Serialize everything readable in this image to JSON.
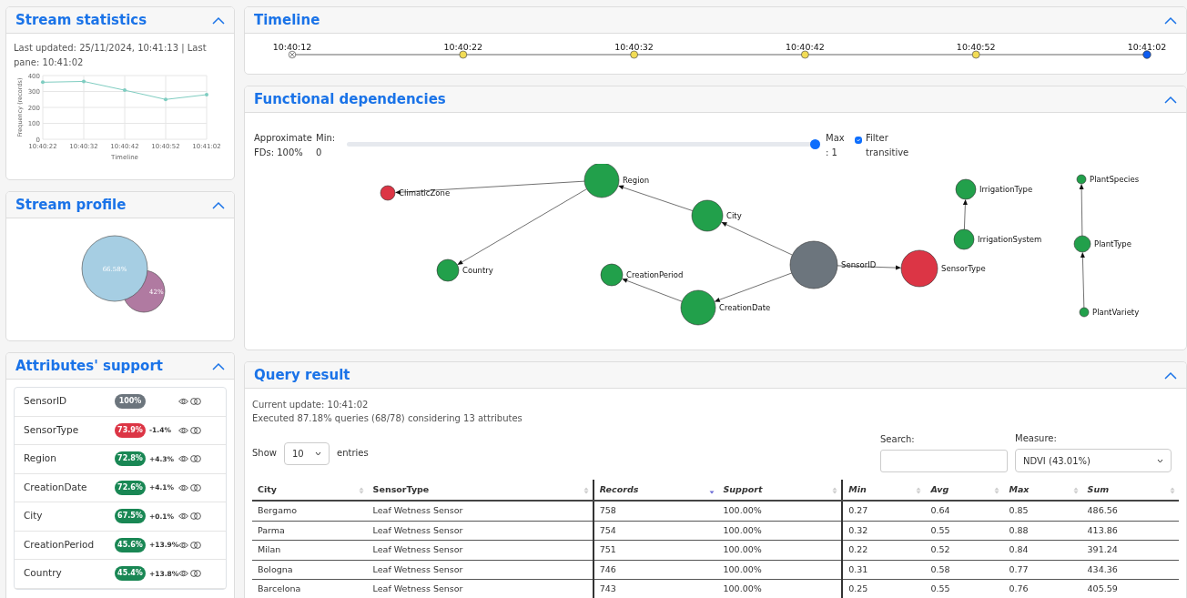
{
  "stream_statistics": {
    "title": "Stream statistics",
    "updated_text": "Last updated: 25/11/2024, 10:41:13 | Last pane: 10:41:02",
    "chart_data": {
      "type": "line",
      "xlabel": "Timeline",
      "ylabel": "Frequency (records)",
      "categories": [
        "10:40:22",
        "10:40:32",
        "10:40:42",
        "10:40:52",
        "10:41:02"
      ],
      "series": [
        {
          "color": "#7fcdc1",
          "values": [
            358,
            363,
            308,
            250,
            280
          ]
        }
      ],
      "ylim": [
        0,
        400
      ],
      "yticks": [
        0,
        100,
        200,
        300,
        400
      ],
      "grid": true
    }
  },
  "stream_profile": {
    "title": "Stream profile",
    "sets": [
      {
        "label": "66.58%",
        "color": "#a6cee3"
      },
      {
        "label": "42%",
        "color": "#b07aa1"
      }
    ]
  },
  "attributes_support": {
    "title": "Attributes' support",
    "rows": [
      {
        "name": "SensorID",
        "support": "100%",
        "color": "#6c757d",
        "delta": ""
      },
      {
        "name": "SensorType",
        "support": "73.9%",
        "color": "#dc3545",
        "delta": "-1.4%"
      },
      {
        "name": "Region",
        "support": "72.8%",
        "color": "#198754",
        "delta": "+4.3%"
      },
      {
        "name": "CreationDate",
        "support": "72.6%",
        "color": "#198754",
        "delta": "+4.1%"
      },
      {
        "name": "City",
        "support": "67.5%",
        "color": "#198754",
        "delta": "+0.1%"
      },
      {
        "name": "CreationPeriod",
        "support": "45.6%",
        "color": "#198754",
        "delta": "+13.9%"
      },
      {
        "name": "Country",
        "support": "45.4%",
        "color": "#198754",
        "delta": "+13.8%"
      }
    ]
  },
  "timeline": {
    "title": "Timeline",
    "points": [
      {
        "time": "10:40:12",
        "kind": "excluded"
      },
      {
        "time": "10:40:22",
        "kind": "pane"
      },
      {
        "time": "10:40:32",
        "kind": "pane"
      },
      {
        "time": "10:40:42",
        "kind": "pane"
      },
      {
        "time": "10:40:52",
        "kind": "pane"
      },
      {
        "time": "10:41:02",
        "kind": "current"
      }
    ]
  },
  "functional_dependencies": {
    "title": "Functional dependencies",
    "approx_label": "Approximate FDs: 100%",
    "min_label": "Min:",
    "min_value": "0",
    "max_label": "Max : 1",
    "slider": {
      "level": 1
    },
    "filter": {
      "label": "Filter transitive",
      "checked": true
    },
    "nodes": [
      {
        "name": "ClimaticZone",
        "color": "#dc3545"
      },
      {
        "name": "Region",
        "color": "#22a04b"
      },
      {
        "name": "City",
        "color": "#22a04b"
      },
      {
        "name": "Country",
        "color": "#22a04b"
      },
      {
        "name": "CreationPeriod",
        "color": "#22a04b"
      },
      {
        "name": "CreationDate",
        "color": "#22a04b"
      },
      {
        "name": "SensorID",
        "color": "#6c757d"
      },
      {
        "name": "SensorType",
        "color": "#dc3545"
      },
      {
        "name": "IrrigationType",
        "color": "#22a04b"
      },
      {
        "name": "IrrigationSystem",
        "color": "#22a04b"
      },
      {
        "name": "PlantSpecies",
        "color": "#22a04b"
      },
      {
        "name": "PlantType",
        "color": "#22a04b"
      },
      {
        "name": "PlantVariety",
        "color": "#22a04b"
      }
    ]
  },
  "query_result": {
    "title": "Query result",
    "current_update": "Current update: 10:41:02",
    "executed": "Executed 87.18% queries (68/78) considering 13 attributes",
    "show_label": "Show",
    "entries_value": "10",
    "entries_label": "entries",
    "search_label": "Search:",
    "measure_label": "Measure:",
    "measure_value": "NDVI (43.01%)",
    "columns": [
      {
        "label": "City",
        "kind": "dimension",
        "sorted": false
      },
      {
        "label": "SensorType",
        "kind": "dimension",
        "sorted": false
      },
      {
        "label": "Records",
        "kind": "count",
        "sorted": true
      },
      {
        "label": "Support",
        "kind": "count",
        "sorted": false
      },
      {
        "label": "Min",
        "kind": "measure",
        "sorted": false
      },
      {
        "label": "Avg",
        "kind": "measure",
        "sorted": false
      },
      {
        "label": "Max",
        "kind": "measure",
        "sorted": false
      },
      {
        "label": "Sum",
        "kind": "measure",
        "sorted": false
      }
    ],
    "rows": [
      [
        "Bergamo",
        "Leaf Wetness Sensor",
        "758",
        "100.00%",
        "0.27",
        "0.64",
        "0.85",
        "486.56"
      ],
      [
        "Parma",
        "Leaf Wetness Sensor",
        "754",
        "100.00%",
        "0.32",
        "0.55",
        "0.88",
        "413.86"
      ],
      [
        "Milan",
        "Leaf Wetness Sensor",
        "751",
        "100.00%",
        "0.22",
        "0.52",
        "0.84",
        "391.24"
      ],
      [
        "Bologna",
        "Leaf Wetness Sensor",
        "746",
        "100.00%",
        "0.31",
        "0.58",
        "0.77",
        "434.36"
      ],
      [
        "Barcelona",
        "Leaf Wetness Sensor",
        "743",
        "100.00%",
        "0.25",
        "0.55",
        "0.76",
        "405.59"
      ]
    ]
  }
}
